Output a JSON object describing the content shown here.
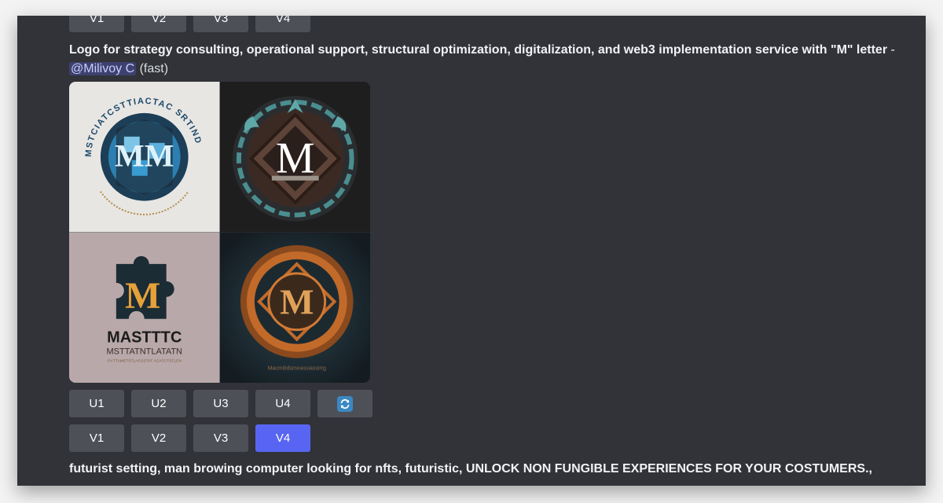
{
  "top_variation_buttons": [
    "V1",
    "V2",
    "V3",
    "V4"
  ],
  "message1": {
    "prompt": "Logo for strategy consulting, operational support, structural optimization, digitalization, and web3 implementation service with \"M\" letter",
    "separator": " - ",
    "mention": "@Milivoy C",
    "mode": " (fast)"
  },
  "image_grid": {
    "tile1": {
      "ring_text": "MSTCIATCSTTIACTAC SRTIND"
    },
    "tile2": {
      "letter": "M"
    },
    "tile3": {
      "letter": "M",
      "wordmark": "MASTTTC",
      "subtitle": "MSTTATNTLATATN",
      "tagline": "OYTTAMETSTLACSSTAT ACATCTSTLEN"
    },
    "tile4": {
      "letter": "M",
      "caption": "Macmitidsmeassiassirrg"
    }
  },
  "upscale_buttons": [
    "U1",
    "U2",
    "U3",
    "U4"
  ],
  "reroll_icon": "refresh-icon",
  "variation_buttons": [
    "V1",
    "V2",
    "V3",
    "V4"
  ],
  "active_variation": "V4",
  "message2": {
    "prompt": "futurist setting, man browing computer looking for nfts, futuristic, UNLOCK NON FUNGIBLE EXPERIENCES FOR YOUR COSTUMERS.,"
  },
  "colors": {
    "background": "#313338",
    "button": "#4e5058",
    "button_active": "#5865f2",
    "mention": "#c9cdfb"
  }
}
